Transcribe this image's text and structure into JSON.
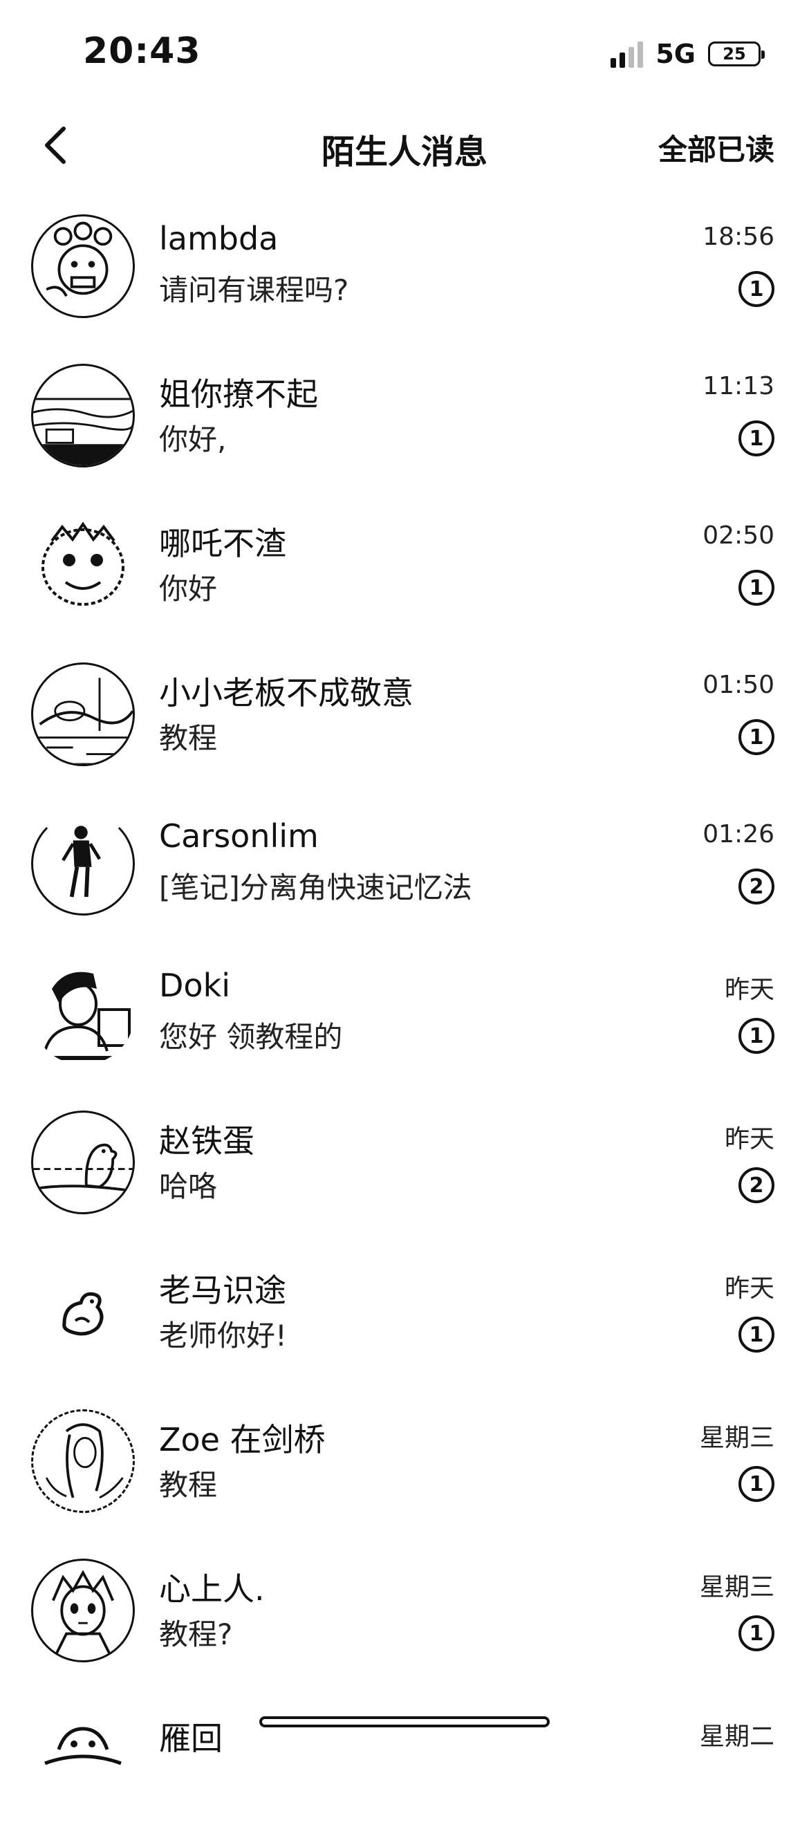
{
  "status_bar": {
    "time": "20:43",
    "network": "5G",
    "battery": "25"
  },
  "header": {
    "title": "陌生人消息",
    "mark_all_read": "全部已读"
  },
  "messages": [
    {
      "name": "lambda",
      "preview": "请问有课程吗?",
      "time": "18:56",
      "unread": "1",
      "avatar_icon": "cartoon-avatar-icon"
    },
    {
      "name": "姐你撩不起",
      "preview": "你好,",
      "time": "11:13",
      "unread": "1",
      "avatar_icon": "seascape-avatar-icon"
    },
    {
      "name": "哪吒不渣",
      "preview": "你好",
      "time": "02:50",
      "unread": "1",
      "avatar_icon": "lion-mask-avatar-icon"
    },
    {
      "name": "小小老板不成敬意",
      "preview": "教程",
      "time": "01:50",
      "unread": "1",
      "avatar_icon": "painting-avatar-icon"
    },
    {
      "name": "Carsonlim",
      "preview": "[笔记]分离角快速记忆法",
      "time": "01:26",
      "unread": "2",
      "avatar_icon": "person-standing-avatar-icon"
    },
    {
      "name": "Doki",
      "preview": "您好 领教程的",
      "time": "昨天",
      "unread": "1",
      "avatar_icon": "illustrated-person-avatar-icon"
    },
    {
      "name": "赵铁蛋",
      "preview": "哈咯",
      "time": "昨天",
      "unread": "2",
      "avatar_icon": "bird-landscape-avatar-icon"
    },
    {
      "name": "老马识途",
      "preview": "老师你好!",
      "time": "昨天",
      "unread": "1",
      "avatar_icon": "bird-avatar-icon"
    },
    {
      "name": "Zoe 在剑桥",
      "preview": "教程",
      "time": "星期三",
      "unread": "1",
      "avatar_icon": "portrait-sketch-avatar-icon"
    },
    {
      "name": "心上人.",
      "preview": "教程?",
      "time": "星期三",
      "unread": "1",
      "avatar_icon": "anime-avatar-icon"
    },
    {
      "name": "雁回",
      "preview": "",
      "time": "星期二",
      "unread": "",
      "avatar_icon": "figure-avatar-icon"
    }
  ]
}
